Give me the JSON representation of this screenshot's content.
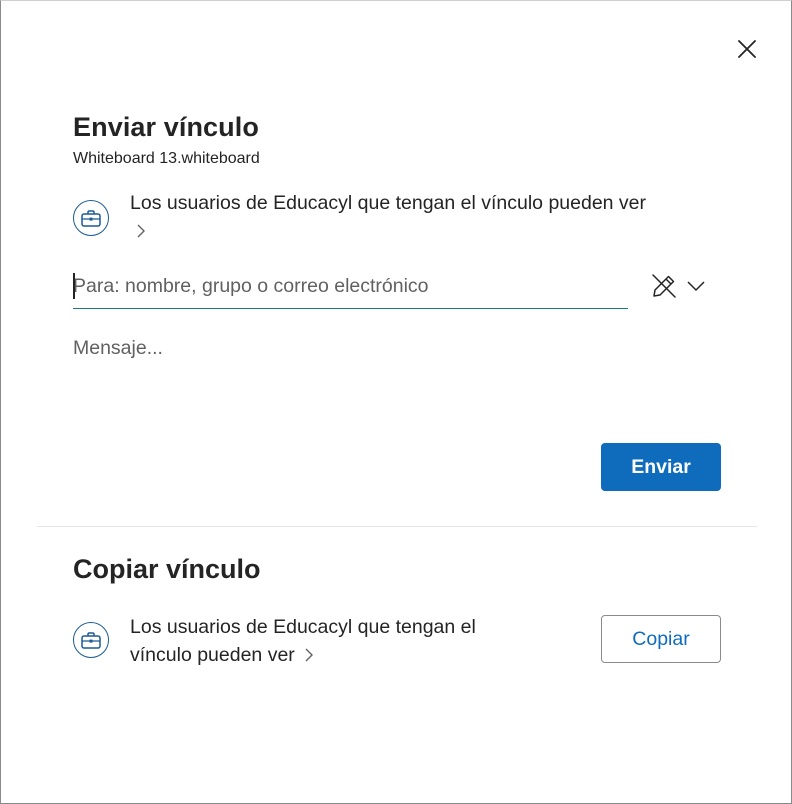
{
  "dialog": {
    "close_icon": "close-icon"
  },
  "send_link": {
    "title": "Enviar vínculo",
    "file_name": "Whiteboard 13.whiteboard",
    "permission_icon": "briefcase-icon",
    "permission_text": "Los usuarios de Educacyl que tengan el vínculo pueden ver",
    "to_placeholder": "Para: nombre, grupo o correo electrónico",
    "to_value": "",
    "edit_icon": "pencil-slash-icon",
    "dropdown_icon": "chevron-down-icon",
    "message_placeholder": "Mensaje...",
    "send_label": "Enviar"
  },
  "copy_link": {
    "title": "Copiar vínculo",
    "permission_icon": "briefcase-icon",
    "permission_line1": "Los usuarios de Educacyl que tengan el",
    "permission_line2": "vínculo pueden ver",
    "copy_label": "Copiar"
  },
  "colors": {
    "accent": "#0f6cbd",
    "underline": "#1a7a80",
    "icon_stroke": "#1b5b94"
  }
}
